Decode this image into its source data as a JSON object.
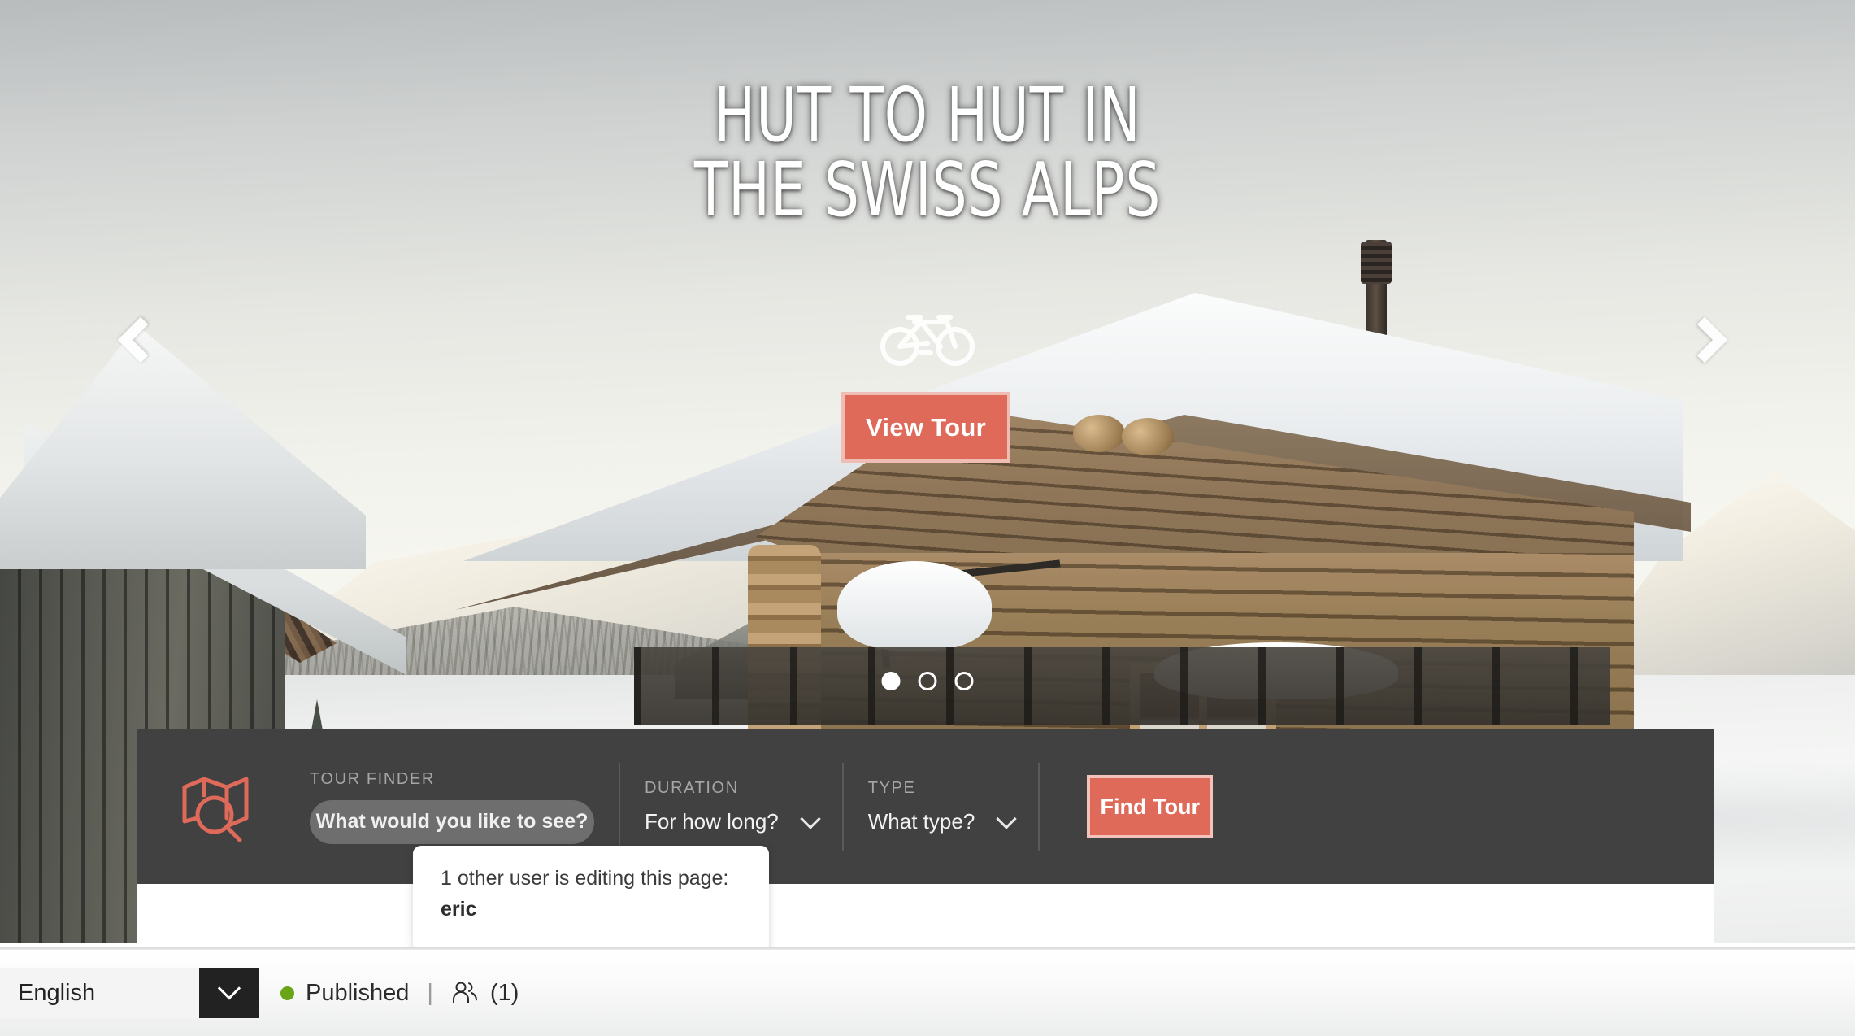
{
  "hero": {
    "title": "HUT TO HUT IN\nTHE SWISS ALPS",
    "activity_icon": "bicycle-icon",
    "cta_label": "View Tour",
    "prev_label": "Previous slide",
    "next_label": "Next slide",
    "slides": [
      {
        "index": 1,
        "active": true
      },
      {
        "index": 2,
        "active": false
      },
      {
        "index": 3,
        "active": false
      }
    ]
  },
  "finder": {
    "icon": "map-search-icon",
    "tour_finder_label": "TOUR FINDER",
    "search_placeholder": "What would you like to see?",
    "search_value": "",
    "duration_label": "DURATION",
    "duration_value": "For how long?",
    "type_label": "TYPE",
    "type_value": "What type?",
    "submit_label": "Find Tour"
  },
  "tooltip": {
    "message": "1 other user is editing this page:",
    "user": "eric"
  },
  "statusbar": {
    "language": "English",
    "status": "Published",
    "separator": "|",
    "users_icon": "people-icon",
    "user_count": "(1)"
  },
  "colors": {
    "accent": "#df6a59",
    "accent_border": "#f0bdb4",
    "bar_bg": "#414141",
    "published_dot": "#6aa517",
    "caret_bg": "#222222"
  }
}
